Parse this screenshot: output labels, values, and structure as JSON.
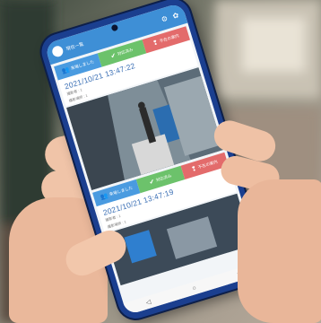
{
  "scene": {
    "description_colors": {
      "skin": "#f0c4a8",
      "phone_body": "#1b3f8f",
      "app_accent": "#3e8fd6"
    }
  },
  "app": {
    "title": "現在一覧",
    "icons": [
      "logo-icon",
      "gear-icon",
      "settings-icon"
    ]
  },
  "events": [
    {
      "timestamp": "2021/10/21 13:47:22",
      "meta1": "撮影者 : 1",
      "meta2": "撮影場所 : 1",
      "buttons": [
        {
          "label": "来場しました",
          "icon": "people-icon"
        },
        {
          "label": "対応済み",
          "icon": "check-icon"
        },
        {
          "label": "不在の案内",
          "icon": "alert-icon"
        }
      ]
    },
    {
      "timestamp": "2021/10/21 13:47:19",
      "meta1": "撮影者 : 1",
      "meta2": "撮影場所 : 1",
      "buttons": [
        {
          "label": "来場しました",
          "icon": "people-icon"
        },
        {
          "label": "対応済み",
          "icon": "check-icon"
        },
        {
          "label": "不在の案内",
          "icon": "alert-icon"
        }
      ]
    }
  ],
  "navbar": {
    "back": "◁",
    "home": "○",
    "recent": "□"
  }
}
